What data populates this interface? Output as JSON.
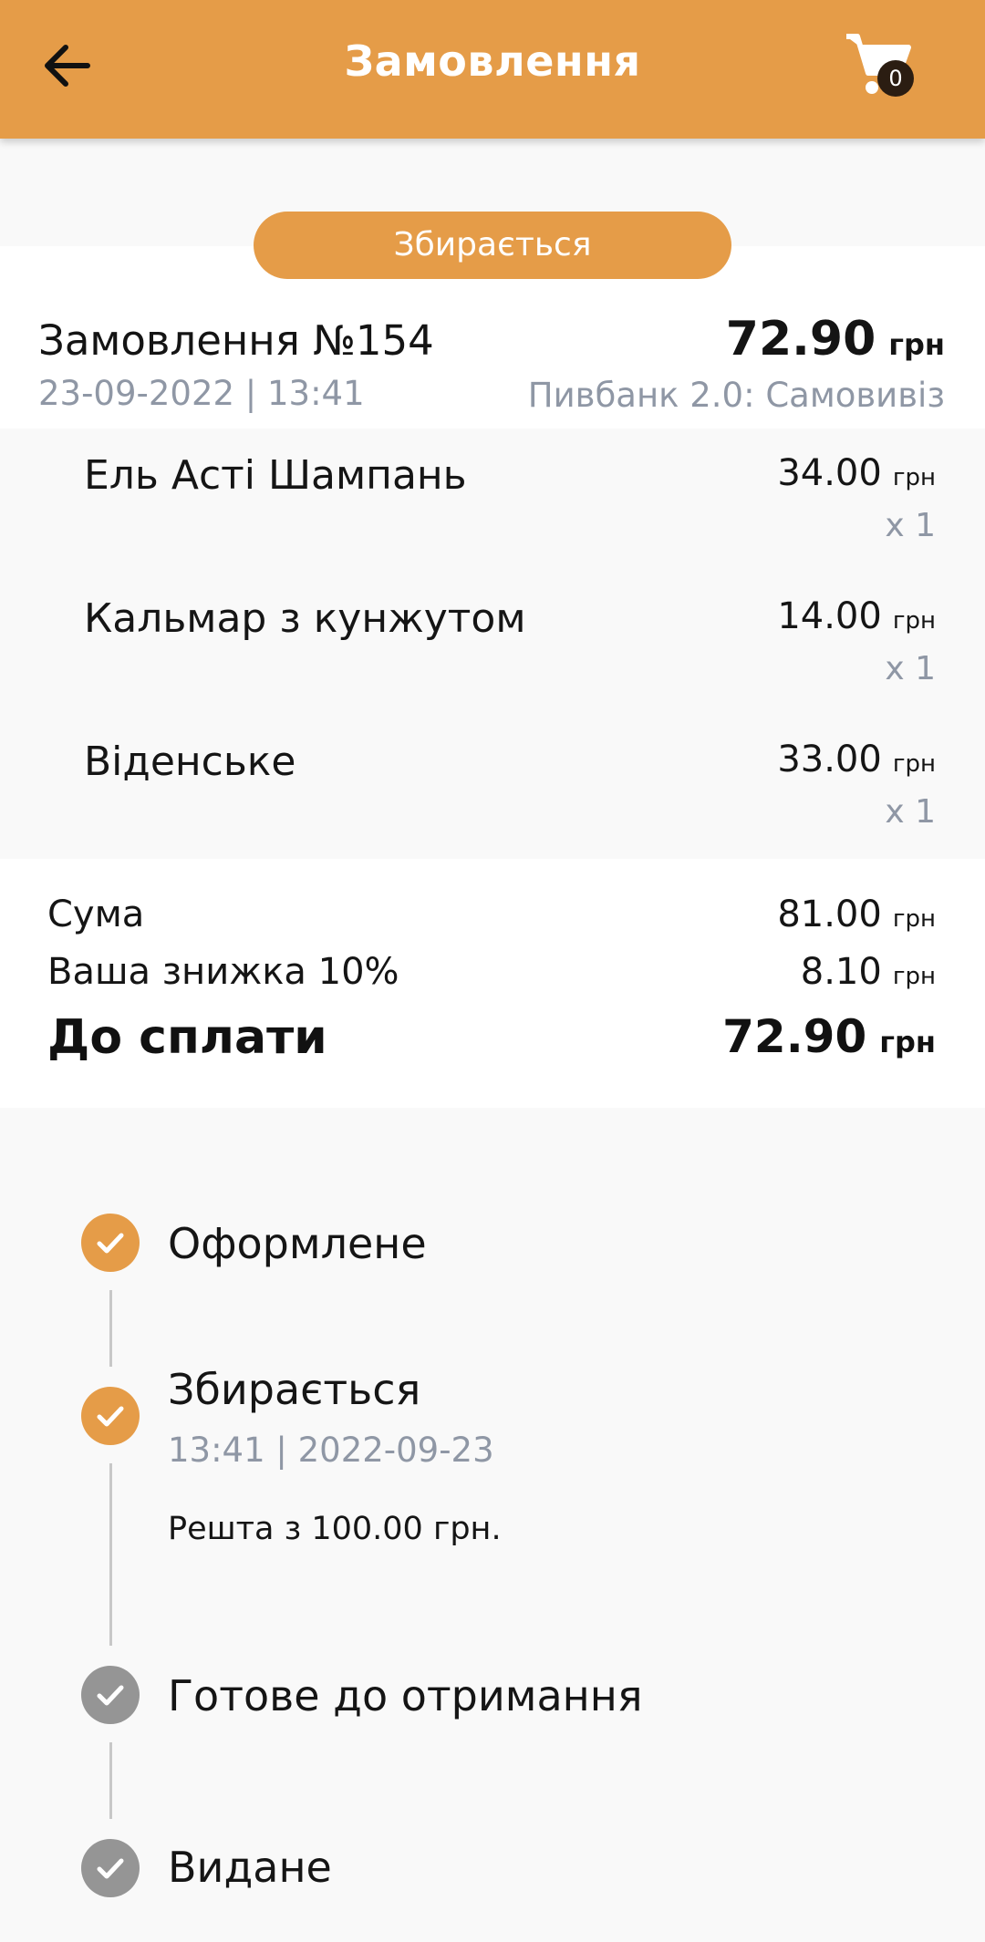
{
  "appbar": {
    "title": "Замовлення",
    "cart_count": "0",
    "back_icon": "arrow-left-icon",
    "cart_icon": "shopping-cart-icon"
  },
  "order": {
    "status": "Збирається",
    "number": "Замовлення №154",
    "total": "72.90",
    "currency": "грн",
    "date": "23-09-2022 | 13:41",
    "shop": "Пивбанк 2.0: Самовивіз"
  },
  "items": [
    {
      "name": "Ель Асті Шампань",
      "price": "34.00",
      "currency": "грн",
      "qty": "x 1"
    },
    {
      "name": "Кальмар з кунжутом",
      "price": "14.00",
      "currency": "грн",
      "qty": "x 1"
    },
    {
      "name": "Віденське",
      "price": "33.00",
      "currency": "грн",
      "qty": "x 1"
    }
  ],
  "summary": {
    "sum_label": "Сума",
    "sum_value": "81.00",
    "discount_label": "Ваша знижка 10%",
    "discount_value": "8.10",
    "pay_label": "До сплати",
    "pay_value": "72.90",
    "currency": "грн"
  },
  "timeline": [
    {
      "title": "Оформлене",
      "state": "done"
    },
    {
      "title": "Збирається",
      "time": "13:41 | 2022-09-23",
      "note": "Решта з 100.00 грн.",
      "state": "done"
    },
    {
      "title": "Готове до отримання",
      "state": "pending"
    },
    {
      "title": "Видане",
      "state": "pending"
    }
  ],
  "colors": {
    "accent": "#e59c48",
    "muted_text": "#8f97a5",
    "pending": "#959595"
  }
}
